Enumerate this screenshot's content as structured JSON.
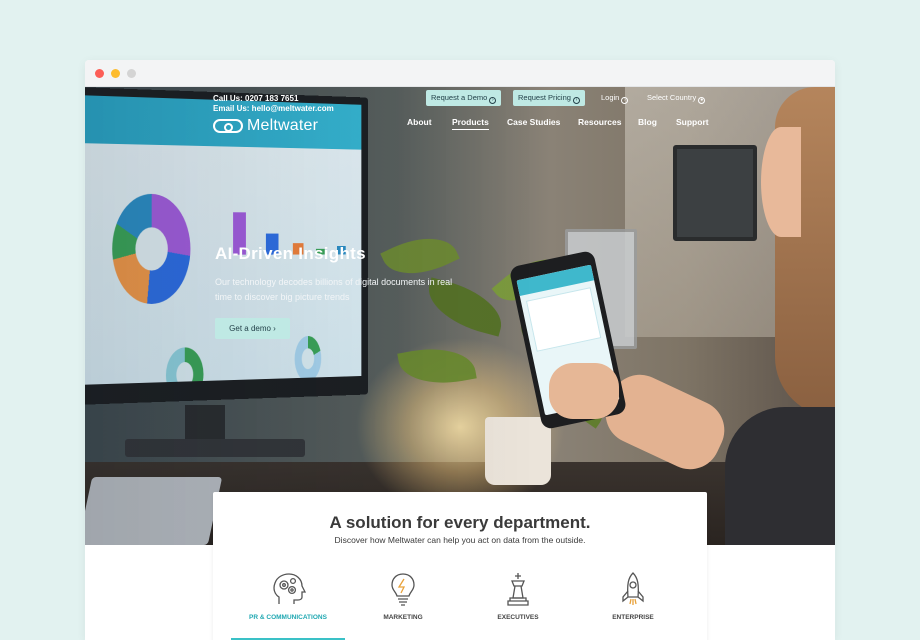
{
  "header": {
    "call_text": "Call Us: 0207 183 7651",
    "email_text": "Email Us: hello@meltwater.com",
    "logo_text": "Meltwater",
    "request_demo": "Request a Demo",
    "request_pricing": "Request Pricing",
    "login": "Login",
    "select_country": "Select Country"
  },
  "nav": {
    "items": [
      {
        "label": "About"
      },
      {
        "label": "Products"
      },
      {
        "label": "Case Studies"
      },
      {
        "label": "Resources"
      },
      {
        "label": "Blog"
      },
      {
        "label": "Support"
      }
    ],
    "active": "Products"
  },
  "hero": {
    "title": "AI-Driven Insights",
    "subtitle": "Our technology decodes billions of digital documents in real time to discover big picture trends",
    "cta": "Get a demo ›"
  },
  "departments": {
    "title": "A solution for every department.",
    "subtitle": "Discover how Meltwater can help you act on data from the outside.",
    "items": [
      {
        "label": "PR & COMMUNICATIONS",
        "icon": "head-gears-icon",
        "active": true
      },
      {
        "label": "MARKETING",
        "icon": "lightbulb-icon",
        "active": false
      },
      {
        "label": "EXECUTIVES",
        "icon": "chess-king-icon",
        "active": false
      },
      {
        "label": "ENTERPRISE",
        "icon": "rocket-icon",
        "active": false
      }
    ]
  },
  "colors": {
    "accent": "#3ac1c7",
    "button_bg": "#bfe9e4",
    "page_bg": "#e2f2f0"
  }
}
